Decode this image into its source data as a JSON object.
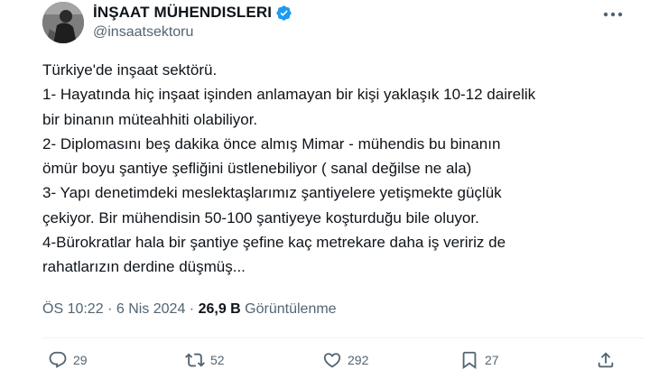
{
  "header": {
    "display_name": "İNŞAAT MÜHENDISLERI",
    "handle": "@insaatsektoru",
    "verified_icon": "verified-badge-icon",
    "more_icon": "more-options-icon"
  },
  "tweet": {
    "lines": [
      "Türkiye'de inşaat sektörü.",
      "1- Hayatında hiç inşaat işinden anlamayan bir kişi yaklaşık 10-12 dairelik",
      "bir binanın müteahhiti olabiliyor.",
      "2- Diplomasını beş dakika önce almış Mimar - mühendis bu binanın",
      "ömür boyu şantiye şefliğini üstlenebiliyor ( sanal değilse ne ala)",
      "3- Yapı denetimdeki meslektaşlarımız şantiyelere yetişmekte güçlük",
      "çekiyor. Bir mühendisin 50-100 şantiyeye koşturduğu bile oluyor.",
      "4-Bürokratlar hala bir şantiye şefine kaç metrekare daha iş veririz de",
      "rahatlarızın derdine düşmüş..."
    ]
  },
  "meta": {
    "time": "ÖS 10:22",
    "separator": "·",
    "date": "6 Nis 2024",
    "views_count": "26,9 B",
    "views_label": "Görüntülenme"
  },
  "actions": {
    "replies": "29",
    "retweets": "52",
    "likes": "292",
    "bookmarks": "27"
  },
  "colors": {
    "text": "#0f1419",
    "secondary": "#536471",
    "verified": "#1d9bf0",
    "divider": "#eff3f4"
  }
}
